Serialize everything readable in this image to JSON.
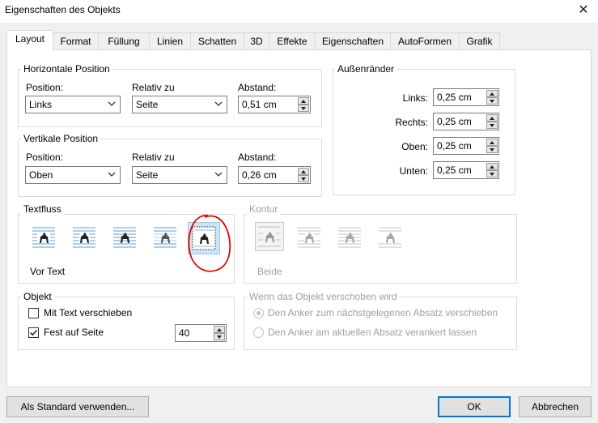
{
  "window": {
    "title": "Eigenschaften des Objekts",
    "close_glyph": "✕"
  },
  "tabs": [
    "Layout",
    "Format",
    "Füllung",
    "Linien",
    "Schatten",
    "3D",
    "Effekte",
    "Eigenschaften",
    "AutoFormen",
    "Grafik"
  ],
  "horizontal": {
    "title": "Horizontale Position",
    "position_label": "Position:",
    "relativ_label": "Relativ zu",
    "abstand_label": "Abstand:",
    "position_value": "Links",
    "relativ_value": "Seite",
    "abstand_value": "0,51 cm"
  },
  "vertical": {
    "title": "Vertikale Position",
    "position_label": "Position:",
    "relativ_label": "Relativ zu",
    "abstand_label": "Abstand:",
    "position_value": "Oben",
    "relativ_value": "Seite",
    "abstand_value": "0,26 cm"
  },
  "margins": {
    "title": "Außenränder",
    "links_label": "Links:",
    "rechts_label": "Rechts:",
    "oben_label": "Oben:",
    "unten_label": "Unten:",
    "links_value": "0,25 cm",
    "rechts_value": "0,25 cm",
    "oben_value": "0,25 cm",
    "unten_value": "0,25 cm"
  },
  "textfluss": {
    "title": "Textfluss",
    "selected_label": "Vor Text"
  },
  "kontur": {
    "title": "Kontur",
    "selected_label": "Beide"
  },
  "objekt": {
    "title": "Objekt",
    "mit_text_label": "Mit Text verschieben",
    "mit_text_checked": false,
    "fest_label": "Fest auf Seite",
    "fest_checked": true,
    "fest_value": "40"
  },
  "verschoben": {
    "title": "Wenn das Objekt verschoben wird",
    "option1": "Den Anker zum nächstgelegenen Absatz verschieben",
    "option2": "Den Anker am aktuellen Absatz verankert lassen"
  },
  "buttons": {
    "standard": "Als Standard verwenden...",
    "ok": "OK",
    "cancel": "Abbrechen"
  },
  "colors": {
    "accent": "#0078d7",
    "annotation": "#e00000"
  },
  "icons": {
    "combo_arrow": "chevron-down-icon",
    "wrap_icons": [
      "wrap-square-icon",
      "wrap-tight-icon",
      "wrap-through-icon",
      "wrap-top-bottom-icon",
      "wrap-in-front-icon"
    ],
    "contour_icons": [
      "contour-square-icon",
      "contour-tight-icon",
      "contour-through-icon",
      "contour-top-bottom-icon"
    ]
  }
}
